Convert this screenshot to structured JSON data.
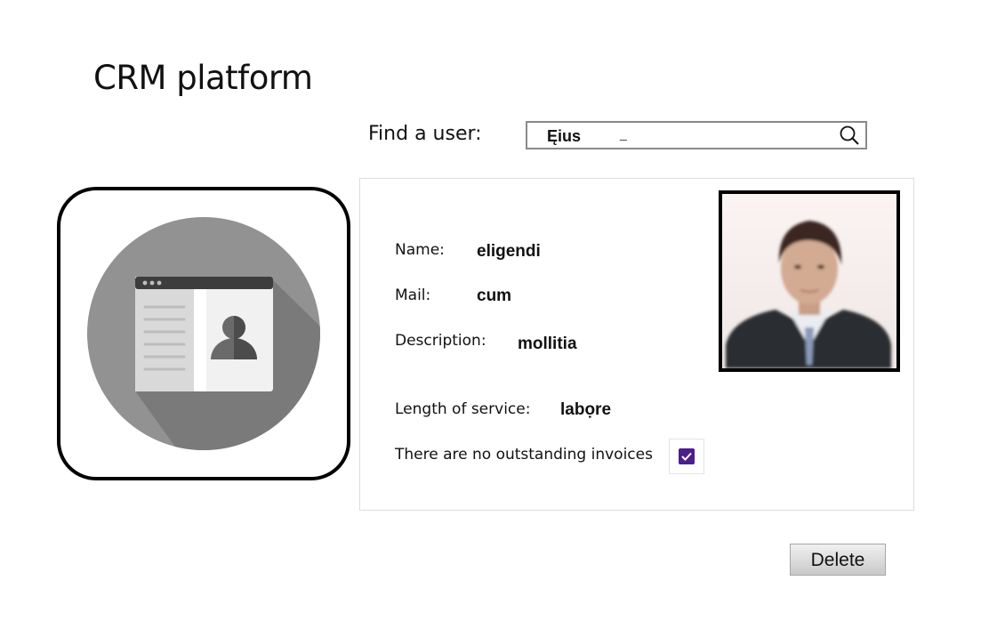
{
  "app": {
    "title": "CRM platform"
  },
  "search": {
    "label": "Find a user:",
    "value": "Ęius",
    "caret": "_",
    "icon": "search-icon"
  },
  "profile_icon": {
    "icon": "contact-card-icon"
  },
  "user": {
    "fields": {
      "name_label": "Name:",
      "name_value": "eligendi",
      "mail_label": "Mail:",
      "mail_value": "cum",
      "description_label": "Description:",
      "description_value": "mollitia",
      "length_label": "Length of service:",
      "length_value": "labọre",
      "invoices_label": "There are no outstanding invoices"
    },
    "invoices_checked": true,
    "photo": "user-photo"
  },
  "actions": {
    "delete_label": "Delete"
  },
  "colors": {
    "checkbox": "#4b1f8c",
    "icon_circle": "#8e8e8e",
    "card_border": "#dcdcdc"
  }
}
